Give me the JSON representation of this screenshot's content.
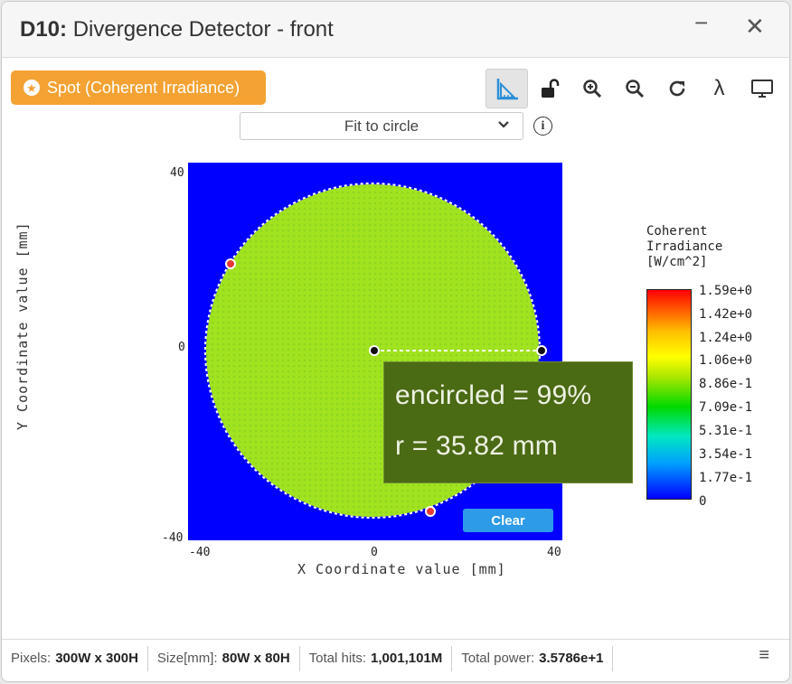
{
  "window": {
    "title_id": "D10:",
    "title_text": "Divergence Detector - front",
    "minimize_icon": "minimize-icon",
    "close_icon": "close-icon"
  },
  "spot_button": {
    "label": "Spot (Coherent Irradiance)",
    "icon": "star-icon"
  },
  "toolbar": {
    "tools": [
      "ruler-icon",
      "unlock-icon",
      "zoom-in-icon",
      "zoom-out-icon",
      "refresh-icon",
      "lambda-icon",
      "monitor-icon"
    ],
    "active": "ruler-icon"
  },
  "fit_select": {
    "value": "Fit to circle"
  },
  "plot": {
    "x_ticks": [
      "-40",
      "0",
      "40"
    ],
    "y_ticks": [
      "40",
      "0",
      "-40"
    ],
    "xlabel": "X Coordinate value [mm]",
    "ylabel": "Y Coordinate value [mm]",
    "background_color": "#0000ff",
    "spot_color": "#a2e320",
    "circle_radius_mm": 35.82
  },
  "tooltip": {
    "encircled": "encircled = 99%",
    "radius": "r = 35.82 mm"
  },
  "clear_button": {
    "label": "Clear"
  },
  "legend": {
    "title_lines": [
      "Coherent",
      "Irradiance",
      "[W/cm^2]"
    ],
    "labels": [
      "1.59e+0",
      "1.42e+0",
      "1.24e+0",
      "1.06e+0",
      "8.86e-1",
      "7.09e-1",
      "5.31e-1",
      "3.54e-1",
      "1.77e-1",
      "0"
    ]
  },
  "status": {
    "pixels_label": "Pixels:",
    "pixels_value": "300W x 300H",
    "size_label": "Size[mm]:",
    "size_value": "80W x 80H",
    "hits_label": "Total hits:",
    "hits_value": "1,001,101M",
    "power_label": "Total power:",
    "power_value": "3.5786e+1"
  },
  "colors": {
    "accent": "#f4a233",
    "clear": "#2e9be8",
    "tooltip_bg": "#4b6a14"
  }
}
